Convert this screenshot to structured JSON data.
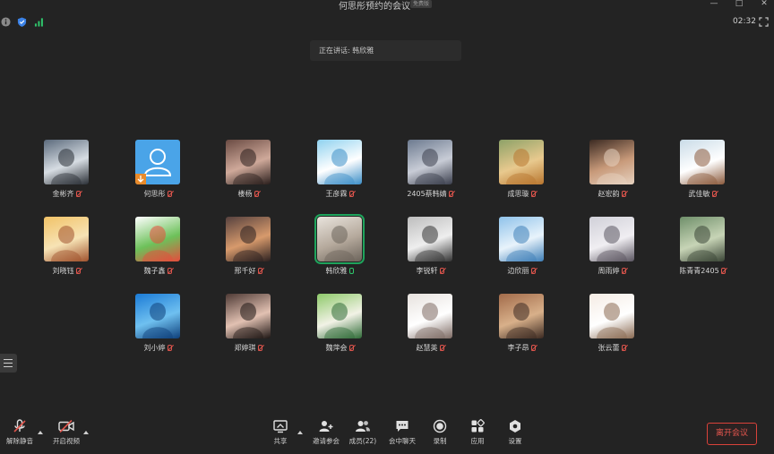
{
  "window": {
    "title": "何思彤预约的会议",
    "edition_badge": "免费版",
    "clock": "02:32"
  },
  "speaking": {
    "text": "正在讲话: 韩欣雅"
  },
  "participants": [
    {
      "name": "金彬齐",
      "mic": "muted",
      "colors": [
        "#5b6a7c",
        "#d7dde3",
        "#2a2f36"
      ]
    },
    {
      "name": "何思彤",
      "mic": "muted",
      "colors": [
        "#4aa4e8",
        "#ffffff",
        "#e88a2a"
      ],
      "default_avatar": true
    },
    {
      "name": "楼杨",
      "mic": "muted",
      "colors": [
        "#6a4b43",
        "#cfa99a",
        "#2a1e1c"
      ]
    },
    {
      "name": "王彦霖",
      "mic": "muted",
      "colors": [
        "#8fd1ef",
        "#ffffff",
        "#3b8ec7"
      ]
    },
    {
      "name": "2405蔡韩婧",
      "mic": "muted",
      "colors": [
        "#6c7a8f",
        "#c8ccd6",
        "#3a3e4c"
      ]
    },
    {
      "name": "成思璇",
      "mic": "muted",
      "colors": [
        "#8da167",
        "#e8c98e",
        "#b8762f"
      ]
    },
    {
      "name": "赵宏韵",
      "mic": "muted",
      "colors": [
        "#3b2a22",
        "#c89a7a",
        "#e6d2c0"
      ]
    },
    {
      "name": "武佳敏",
      "mic": "muted",
      "colors": [
        "#c9dbe7",
        "#ffffff",
        "#8b5a3c"
      ]
    },
    {
      "name": "刘晓钰",
      "mic": "muted",
      "colors": [
        "#f1c267",
        "#f7e3b5",
        "#a0522d"
      ]
    },
    {
      "name": "魏子鑫",
      "mic": "muted",
      "colors": [
        "#ffffff",
        "#6dc15a",
        "#e74c3c"
      ]
    },
    {
      "name": "邢千好",
      "mic": "muted",
      "colors": [
        "#56413e",
        "#d79a6c",
        "#2b2020"
      ]
    },
    {
      "name": "韩欣雅",
      "mic": "on",
      "active": true,
      "colors": [
        "#e9e4dd",
        "#b5a99c",
        "#6c645b"
      ]
    },
    {
      "name": "李锐轩",
      "mic": "muted",
      "colors": [
        "#bdbdbd",
        "#eeeeee",
        "#333333"
      ]
    },
    {
      "name": "边欣丽",
      "mic": "muted",
      "colors": [
        "#8fc2ea",
        "#e8f3fb",
        "#3e7fb8"
      ]
    },
    {
      "name": "周雨婷",
      "mic": "muted",
      "colors": [
        "#d0d0d8",
        "#f0eef2",
        "#5a5560"
      ]
    },
    {
      "name": "陈青青2405",
      "mic": "muted",
      "colors": [
        "#6f8f6a",
        "#c7d4b6",
        "#3a4536"
      ]
    },
    {
      "name": "刘小婷",
      "mic": "muted",
      "colors": [
        "#1b7bd6",
        "#6fc0f0",
        "#0e3f7a"
      ]
    },
    {
      "name": "郑婷琪",
      "mic": "muted",
      "colors": [
        "#4e3a35",
        "#e2c1b2",
        "#1e1614"
      ]
    },
    {
      "name": "魏萍会",
      "mic": "muted",
      "colors": [
        "#8ec96a",
        "#f2f2e6",
        "#2f6b37"
      ]
    },
    {
      "name": "赵慧英",
      "mic": "muted",
      "colors": [
        "#e7e2de",
        "#ffffff",
        "#7d6a63"
      ]
    },
    {
      "name": "李子昂",
      "mic": "muted",
      "colors": [
        "#a26b4a",
        "#d8b08a",
        "#3c2a22"
      ]
    },
    {
      "name": "张云蕾",
      "mic": "muted",
      "colors": [
        "#f5ece4",
        "#ffffff",
        "#8a6a52"
      ]
    }
  ],
  "toolbar": {
    "unmute": {
      "label": "解除静音",
      "icon": "mic-muted-icon"
    },
    "video": {
      "label": "开启视频",
      "icon": "camera-off-icon"
    },
    "share": {
      "label": "共享",
      "icon": "share-screen-icon"
    },
    "invite": {
      "label": "邀请参会",
      "icon": "add-person-icon"
    },
    "members": {
      "label": "成员(22)",
      "icon": "members-icon"
    },
    "chat": {
      "label": "会中聊天",
      "icon": "chat-icon"
    },
    "record": {
      "label": "录制",
      "icon": "record-icon"
    },
    "apps": {
      "label": "应用",
      "icon": "apps-icon"
    },
    "settings": {
      "label": "设置",
      "icon": "settings-icon"
    }
  },
  "leave": {
    "label": "离开会议",
    "color": "#e7564e"
  },
  "colors": {
    "background": "#232323",
    "active_speaker": "#1ea35b",
    "muted_mic": "#e0554d",
    "signal": "#2fc46b",
    "shield": "#3b82e6"
  }
}
